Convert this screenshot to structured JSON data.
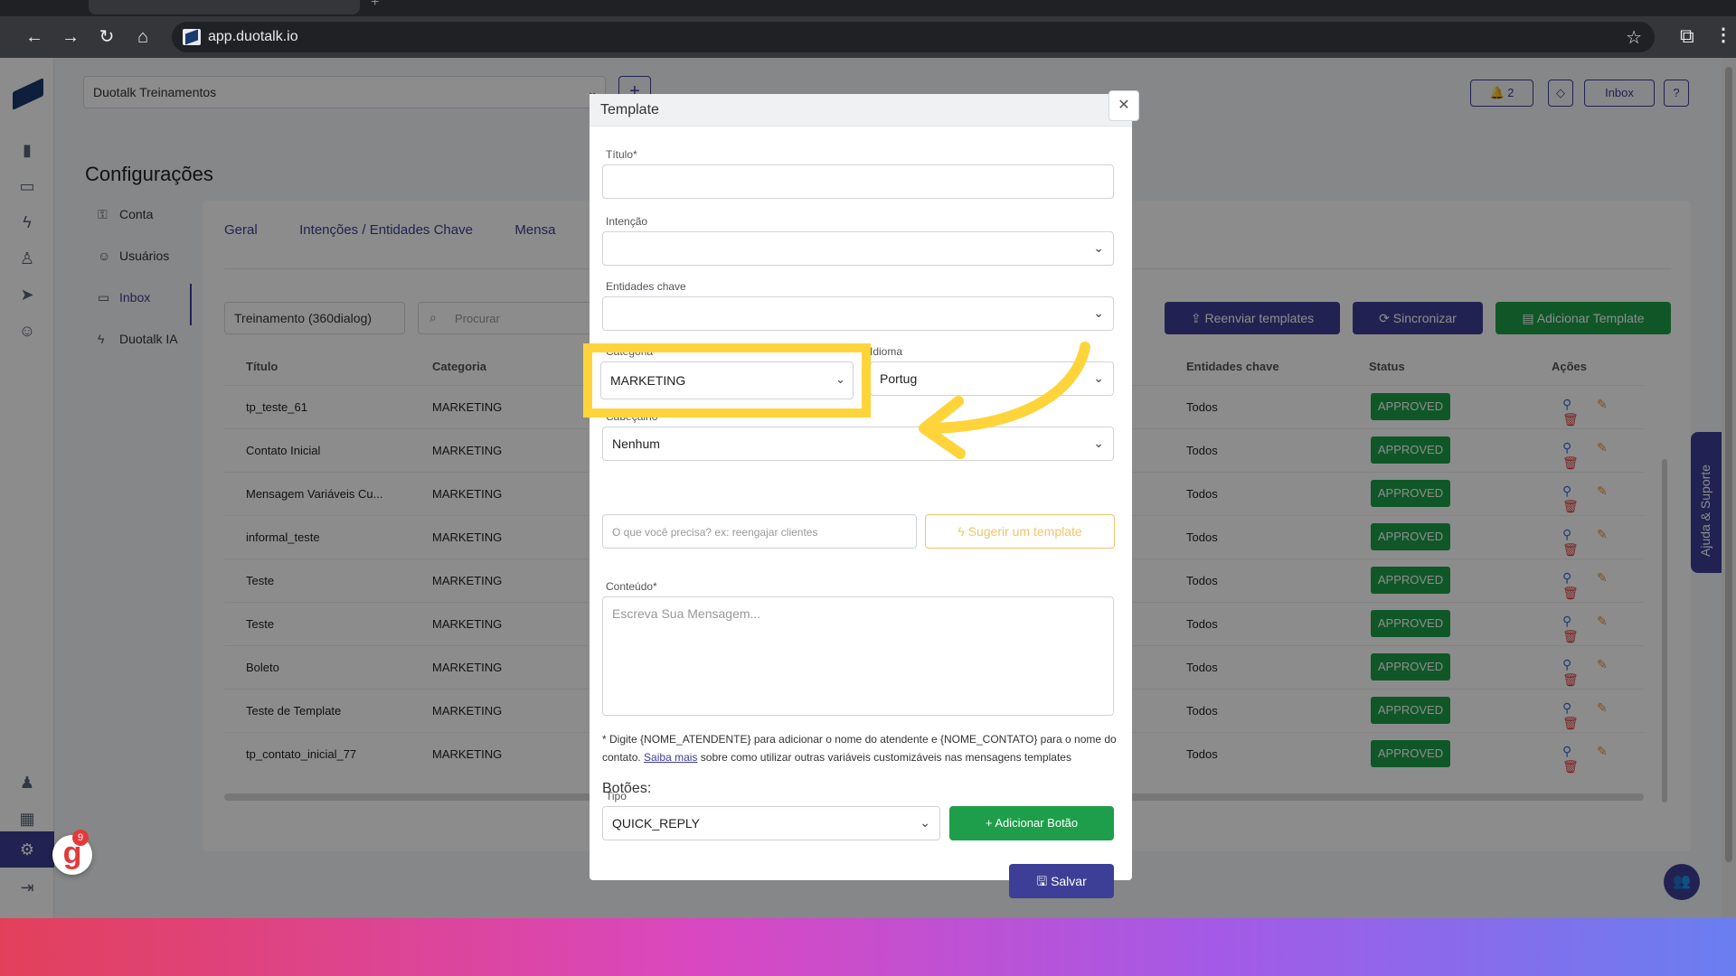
{
  "browser": {
    "url": "app.duotalk.io"
  },
  "app": {
    "workspace": "Duotalk Treinamentos",
    "header_buttons": {
      "notifications_count": "2",
      "inbox": "Inbox",
      "help": "?"
    },
    "page_title": "Configurações",
    "settings_menu": [
      {
        "label": "Conta"
      },
      {
        "label": "Usuários"
      },
      {
        "label": "Inbox"
      },
      {
        "label": "Duotalk IA"
      }
    ],
    "tabs": [
      "Geral",
      "Intenções / Entidades Chave",
      "Mensa"
    ],
    "filter": {
      "selected": "Treinamento (360dialog)",
      "search_placeholder": "Procurar"
    },
    "actions": {
      "resend": "Reenviar templates",
      "sync": "Sincronizar",
      "add": "Adicionar Template"
    },
    "table": {
      "columns": {
        "title": "Título",
        "category": "Categoria",
        "entities": "Entidades chave",
        "status": "Status",
        "actions": "Ações"
      },
      "rows": [
        {
          "title": "tp_teste_61",
          "category": "MARKETING",
          "entities": "Todos",
          "status": "APPROVED"
        },
        {
          "title": "Contato Inicial",
          "category": "MARKETING",
          "entities": "Todos",
          "status": "APPROVED"
        },
        {
          "title": "Mensagem Variáveis Cu...",
          "category": "MARKETING",
          "entities": "Todos",
          "status": "APPROVED"
        },
        {
          "title": "informal_teste",
          "category": "MARKETING",
          "entities": "Todos",
          "status": "APPROVED"
        },
        {
          "title": "Teste",
          "category": "MARKETING",
          "entities": "Todos",
          "status": "APPROVED"
        },
        {
          "title": "Teste",
          "category": "MARKETING",
          "entities": "Todos",
          "status": "APPROVED"
        },
        {
          "title": "Boleto",
          "category": "MARKETING",
          "entities": "Todos",
          "status": "APPROVED"
        },
        {
          "title": "Teste de Template",
          "category": "MARKETING",
          "entities": "Todos",
          "status": "APPROVED"
        },
        {
          "title": "tp_contato_inicial_77",
          "category": "MARKETING",
          "entities": "Todos",
          "status": "APPROVED"
        }
      ]
    },
    "help_tab": "Ajuda & Suporte",
    "badge_count": "9"
  },
  "modal": {
    "title": "Template",
    "fields": {
      "title_label": "Título*",
      "intent_label": "Intenção",
      "entities_label": "Entidades chave",
      "category_label": "Categoria",
      "category_value": "MARKETING",
      "language_label": "Idioma",
      "language_value": "Portug",
      "header_label": "Cabeçalho",
      "header_value": "Nenhum",
      "suggest_placeholder": "O que você precisa? ex: reengajar clientes",
      "suggest_button": "Sugerir um template",
      "content_label": "Conteúdo*",
      "content_placeholder": "Escreva Sua Mensagem..."
    },
    "hint_before": "* Digite {NOME_ATENDENTE} para adicionar o nome do atendente e {NOME_CONTATO} para o nome do contato.",
    "hint_link": "Saiba mais",
    "hint_after": "sobre como utilizar outras variáveis customizáveis nas mensagens templates",
    "buttons_title": "Botões:",
    "type_label": "Tipo",
    "type_value": "QUICK_REPLY",
    "add_button": "Adicionar Botão",
    "save_button": "Salvar"
  },
  "colors": {
    "primary": "#3d3f96",
    "success": "#1e9e4a",
    "highlight": "#ffd43b",
    "warning": "#f0c46f"
  }
}
